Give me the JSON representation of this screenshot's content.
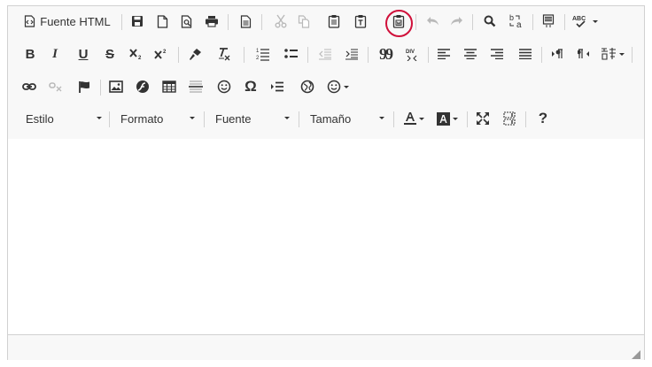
{
  "toolbar": {
    "row1": {
      "source_label": "Fuente HTML"
    },
    "row2": {
      "bold_label": "B",
      "italic_label": "I",
      "underline_label": "U",
      "strike_label": "S",
      "quote_label": "99",
      "div_label": "DIV"
    },
    "row3": {
      "omega_label": "Ω"
    },
    "row4": {
      "style_label": "Estilo",
      "format_label": "Formato",
      "font_label": "Fuente",
      "size_label": "Tamaño",
      "help_label": "?"
    }
  },
  "highlight_color": "#d0103a",
  "icons": [
    "source-icon",
    "save-icon",
    "new-page-icon",
    "preview-icon",
    "print-icon",
    "templates-icon",
    "cut-icon",
    "copy-icon",
    "paste-icon",
    "paste-text-icon",
    "paste-word-icon",
    "undo-icon",
    "redo-icon",
    "find-icon",
    "replace-icon",
    "select-all-icon",
    "spellcheck-icon",
    "bold-icon",
    "italic-icon",
    "underline-icon",
    "strikethrough-icon",
    "subscript-icon",
    "superscript-icon",
    "copy-format-icon",
    "remove-format-icon",
    "numbered-list-icon",
    "bulleted-list-icon",
    "outdent-icon",
    "indent-icon",
    "blockquote-icon",
    "create-div-icon",
    "align-left-icon",
    "align-center-icon",
    "align-right-icon",
    "justify-icon",
    "ltr-icon",
    "rtl-icon",
    "language-icon",
    "link-icon",
    "unlink-icon",
    "anchor-icon",
    "image-icon",
    "flash-icon",
    "table-icon",
    "horizontal-line-icon",
    "smiley-icon",
    "special-char-icon",
    "page-break-icon",
    "iframe-icon",
    "emoji-icon",
    "text-color-icon",
    "bg-color-icon",
    "maximize-icon",
    "show-blocks-icon",
    "help-icon",
    "resize-icon"
  ]
}
